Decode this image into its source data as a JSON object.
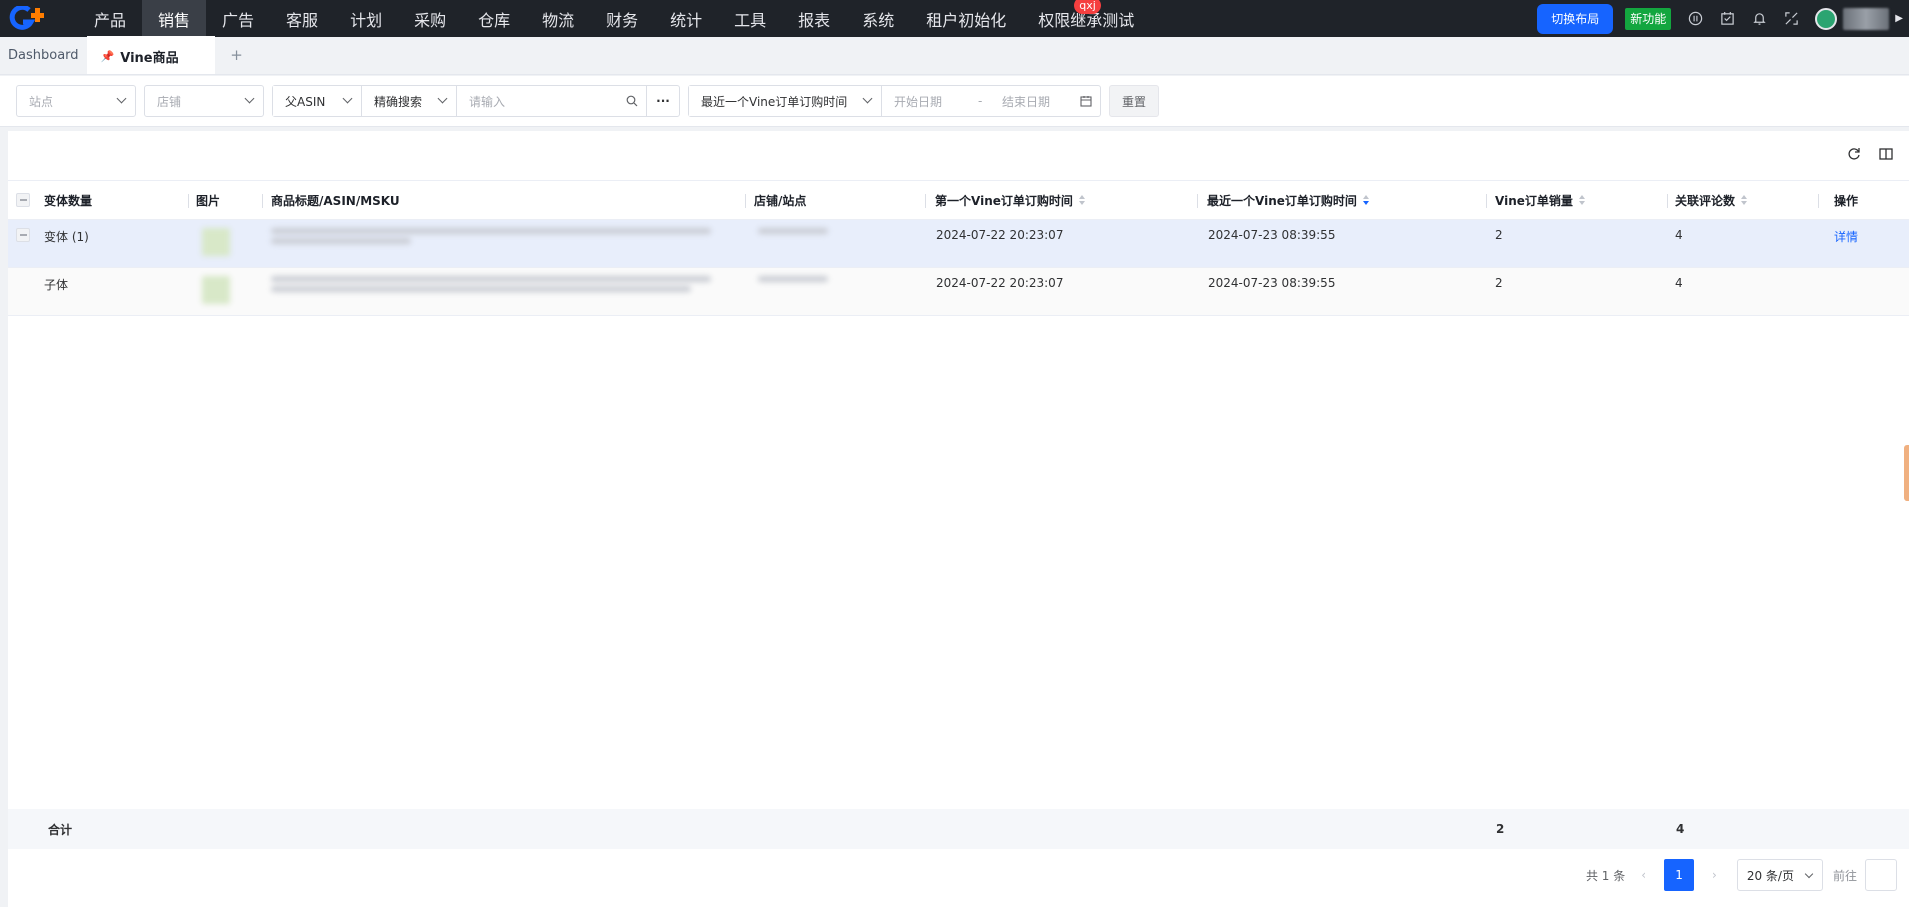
{
  "nav": {
    "items": [
      "产品",
      "销售",
      "广告",
      "客服",
      "计划",
      "采购",
      "仓库",
      "物流",
      "财务",
      "统计",
      "工具",
      "报表",
      "系统",
      "租户初始化",
      "权限继承测试"
    ],
    "active_index": 1,
    "badge": "qxj",
    "switch_layout": "切换布局",
    "new_feature": "新功能"
  },
  "tabs": {
    "dashboard": "Dashboard",
    "active": "Vine商品",
    "add": "+"
  },
  "filters": {
    "site": "站点",
    "shop": "店铺",
    "asin_type": "父ASIN",
    "search_mode": "精确搜索",
    "search_placeholder": "请输入",
    "date_type": "最近一个Vine订单订购时间",
    "start_date": "开始日期",
    "date_sep": "-",
    "end_date": "结束日期",
    "reset": "重置"
  },
  "table": {
    "columns": [
      "变体数量",
      "图片",
      "商品标题/ASIN/MSKU",
      "店铺/站点",
      "第一个Vine订单订购时间",
      "最近一个Vine订单订购时间",
      "Vine订单销量",
      "关联评论数",
      "操作"
    ],
    "rows": [
      {
        "variant": "变体 (1)",
        "first_time": "2024-07-22 20:23:07",
        "last_time": "2024-07-23 08:39:55",
        "sales": "2",
        "reviews": "4",
        "action": "详情"
      },
      {
        "variant": "子体",
        "first_time": "2024-07-22 20:23:07",
        "last_time": "2024-07-23 08:39:55",
        "sales": "2",
        "reviews": "4",
        "action": ""
      }
    ],
    "footer": {
      "label": "合计",
      "sales": "2",
      "reviews": "4"
    }
  },
  "pagination": {
    "total": "共 1 条",
    "current": "1",
    "page_size": "20 条/页",
    "goto": "前往"
  }
}
